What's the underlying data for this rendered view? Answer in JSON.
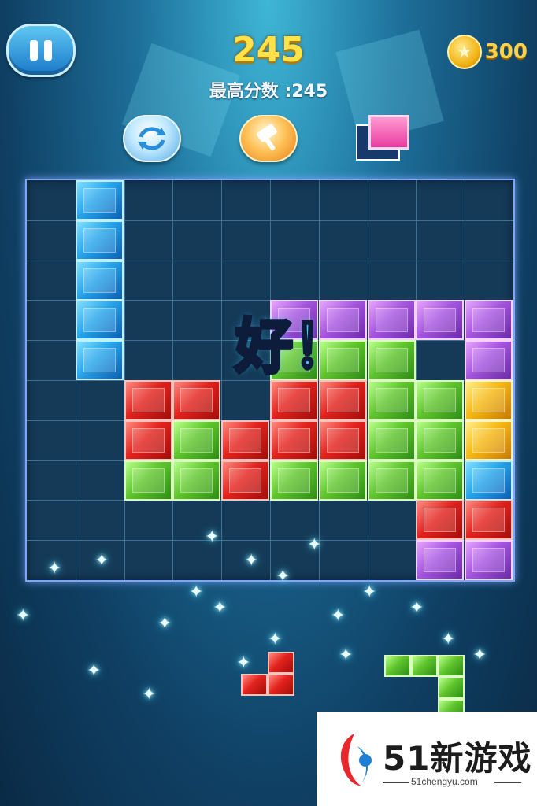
{
  "hud": {
    "score": "245",
    "best_score_label": "最高分数 :245",
    "coins": "300"
  },
  "tools": {
    "rotate_icon": "rotate-arrows-icon",
    "hammer_icon": "hammer-icon"
  },
  "board": {
    "cols": 10,
    "rows": 10,
    "cells": [
      {
        "r": 0,
        "c": 1,
        "color": "blue"
      },
      {
        "r": 1,
        "c": 1,
        "color": "blue"
      },
      {
        "r": 2,
        "c": 1,
        "color": "blue"
      },
      {
        "r": 3,
        "c": 1,
        "color": "blue"
      },
      {
        "r": 4,
        "c": 1,
        "color": "blue"
      },
      {
        "r": 3,
        "c": 5,
        "color": "purple"
      },
      {
        "r": 3,
        "c": 6,
        "color": "purple"
      },
      {
        "r": 3,
        "c": 7,
        "color": "purple"
      },
      {
        "r": 3,
        "c": 8,
        "color": "purple"
      },
      {
        "r": 3,
        "c": 9,
        "color": "purple"
      },
      {
        "r": 4,
        "c": 5,
        "color": "green"
      },
      {
        "r": 4,
        "c": 6,
        "color": "green"
      },
      {
        "r": 4,
        "c": 7,
        "color": "green"
      },
      {
        "r": 4,
        "c": 9,
        "color": "purple"
      },
      {
        "r": 5,
        "c": 2,
        "color": "red"
      },
      {
        "r": 5,
        "c": 3,
        "color": "red"
      },
      {
        "r": 5,
        "c": 5,
        "color": "red"
      },
      {
        "r": 5,
        "c": 6,
        "color": "red"
      },
      {
        "r": 5,
        "c": 7,
        "color": "green"
      },
      {
        "r": 5,
        "c": 8,
        "color": "green"
      },
      {
        "r": 5,
        "c": 9,
        "color": "yellow"
      },
      {
        "r": 6,
        "c": 2,
        "color": "red"
      },
      {
        "r": 6,
        "c": 3,
        "color": "green"
      },
      {
        "r": 6,
        "c": 4,
        "color": "red"
      },
      {
        "r": 6,
        "c": 5,
        "color": "red"
      },
      {
        "r": 6,
        "c": 6,
        "color": "red"
      },
      {
        "r": 6,
        "c": 7,
        "color": "green"
      },
      {
        "r": 6,
        "c": 8,
        "color": "green"
      },
      {
        "r": 6,
        "c": 9,
        "color": "yellow"
      },
      {
        "r": 7,
        "c": 2,
        "color": "green"
      },
      {
        "r": 7,
        "c": 3,
        "color": "green"
      },
      {
        "r": 7,
        "c": 4,
        "color": "red"
      },
      {
        "r": 7,
        "c": 5,
        "color": "green"
      },
      {
        "r": 7,
        "c": 6,
        "color": "green"
      },
      {
        "r": 7,
        "c": 7,
        "color": "green"
      },
      {
        "r": 7,
        "c": 8,
        "color": "green"
      },
      {
        "r": 7,
        "c": 9,
        "color": "blue"
      },
      {
        "r": 8,
        "c": 8,
        "color": "red"
      },
      {
        "r": 8,
        "c": 9,
        "color": "red"
      },
      {
        "r": 9,
        "c": 8,
        "color": "purple"
      },
      {
        "r": 9,
        "c": 9,
        "color": "purple"
      }
    ]
  },
  "combo_text": "好！",
  "logo": {
    "main": "51新游戏",
    "sub": "51chengyu.com"
  }
}
